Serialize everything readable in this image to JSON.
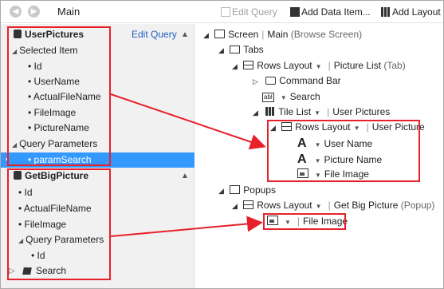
{
  "toolbar": {
    "title": "Main",
    "edit_query": "Edit Query",
    "add_data_item": "Add Data Item...",
    "add_layout": "Add Layout"
  },
  "left": {
    "user_pictures": "UserPictures",
    "edit_query_link": "Edit Query",
    "selected_item": "Selected Item",
    "id": "Id",
    "user_name": "UserName",
    "actual_file_name": "ActualFileName",
    "file_image": "FileImage",
    "picture_name": "PictureName",
    "query_parameters": "Query Parameters",
    "param_search": "paramSearch",
    "get_big_picture": "GetBigPicture",
    "gbp_id": "Id",
    "gbp_actual_file_name": "ActualFileName",
    "gbp_file_image": "FileImage",
    "gbp_query_parameters": "Query Parameters",
    "gbp_param_id": "Id",
    "search": "Search"
  },
  "right": {
    "screen": "Screen",
    "screen_name": "Main",
    "screen_type": "(Browse Screen)",
    "tabs": "Tabs",
    "rows_layout": "Rows Layout",
    "picture_list": "Picture List",
    "tab_suffix": "(Tab)",
    "command_bar": "Command Bar",
    "search": "Search",
    "tile_list": "Tile List",
    "user_pictures": "User Pictures",
    "rows_layout_2": "Rows Layout",
    "user_picture": "User Picture",
    "user_name": "User Name",
    "picture_name": "Picture Name",
    "file_image": "File Image",
    "popups": "Popups",
    "rows_layout_3": "Rows Layout",
    "get_big_picture": "Get Big Picture",
    "popup_suffix": "(Popup)",
    "popup_file_image": "File Image"
  },
  "colors": {
    "annotation": "#e8202a",
    "selection": "#3399ff",
    "link": "#1e5ebf"
  }
}
